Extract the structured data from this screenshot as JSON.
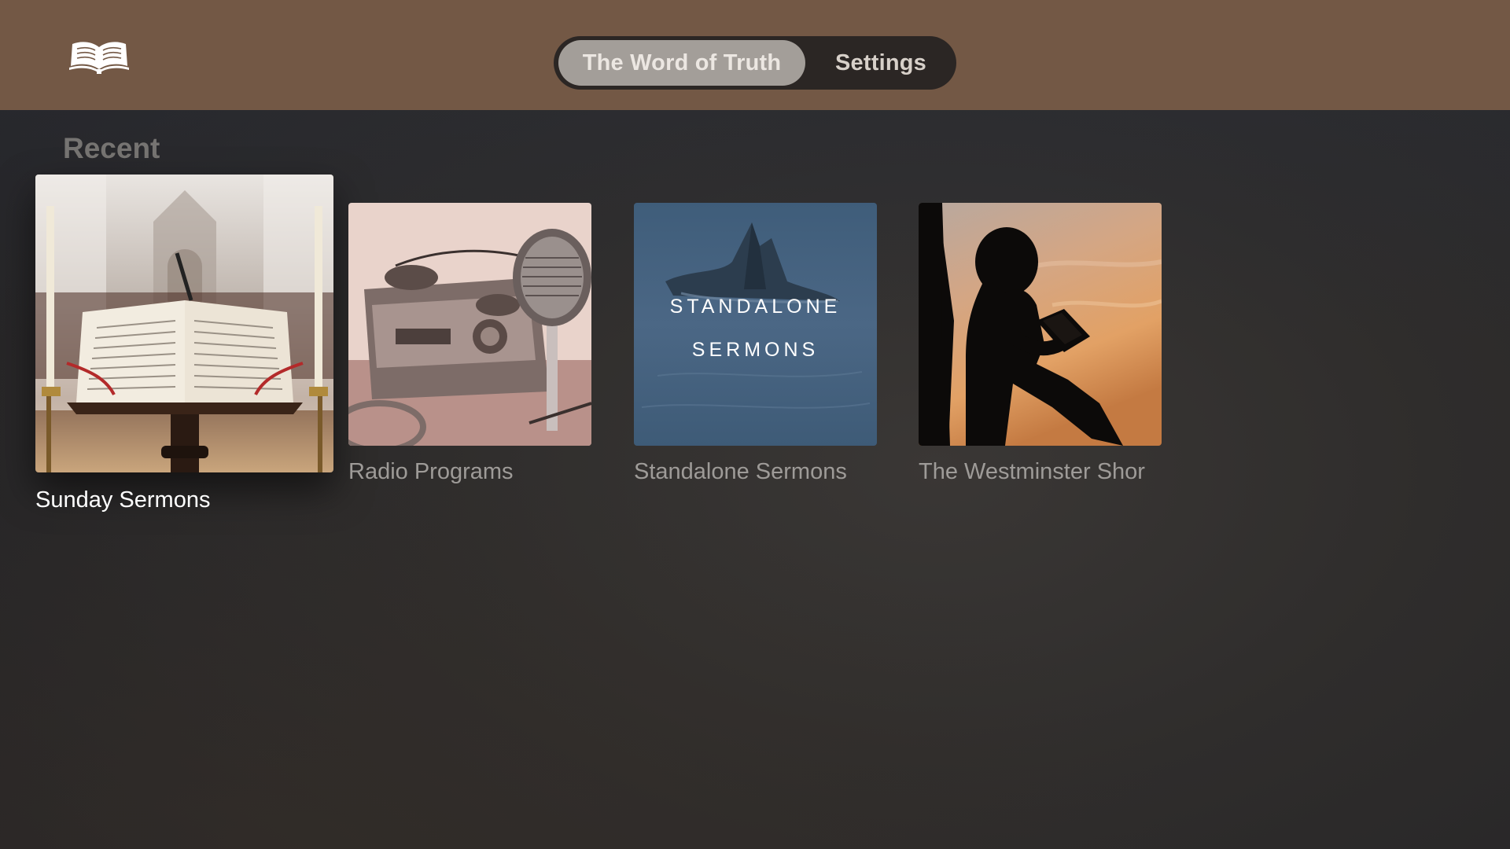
{
  "header": {
    "logo_icon": "open-book-icon",
    "tabs": [
      {
        "label": "The Word of Truth",
        "selected": true
      },
      {
        "label": "Settings",
        "selected": false
      }
    ]
  },
  "recent": {
    "title": "Recent",
    "items": [
      {
        "title": "Sunday Sermons",
        "focused": true,
        "art": "bible-on-lectern"
      },
      {
        "title": "Radio Programs",
        "focused": false,
        "art": "vintage-microphone-radio"
      },
      {
        "title": "Standalone Sermons",
        "focused": false,
        "art": "sea-rocks",
        "art_text": [
          "STANDALONE",
          "SERMONS"
        ]
      },
      {
        "title": "The Westminster Shor",
        "focused": false,
        "art": "child-reading-silhouette"
      }
    ]
  },
  "colors": {
    "topbar": "#735845",
    "tabbar_bg": "#2b2624",
    "tab_selected": "#a39e99",
    "label_focused": "#ffffff",
    "label_default": "#9e9b98"
  }
}
